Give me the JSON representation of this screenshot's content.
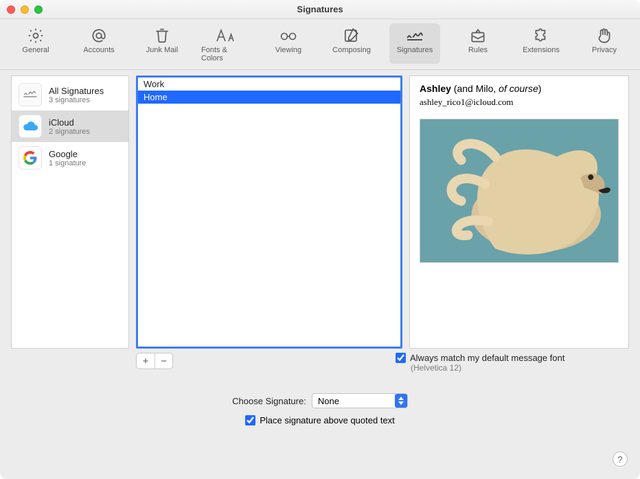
{
  "window": {
    "title": "Signatures"
  },
  "toolbar": {
    "items": [
      {
        "label": "General"
      },
      {
        "label": "Accounts"
      },
      {
        "label": "Junk Mail"
      },
      {
        "label": "Fonts & Colors"
      },
      {
        "label": "Viewing"
      },
      {
        "label": "Composing"
      },
      {
        "label": "Signatures"
      },
      {
        "label": "Rules"
      },
      {
        "label": "Extensions"
      },
      {
        "label": "Privacy"
      }
    ]
  },
  "accounts": [
    {
      "name": "All Signatures",
      "sub": "3 signatures",
      "icon": "all"
    },
    {
      "name": "iCloud",
      "sub": "2 signatures",
      "icon": "cloud"
    },
    {
      "name": "Google",
      "sub": "1 signature",
      "icon": "google"
    }
  ],
  "signatures": [
    {
      "label": "Work"
    },
    {
      "label": "Home"
    }
  ],
  "preview": {
    "name_bold": "Ashley",
    "name_paren_plain": " (and Milo, ",
    "name_italic": "of course",
    "name_paren_close": ")",
    "email": "ashley_rico1@icloud.com"
  },
  "buttons": {
    "add": "+",
    "remove": "−"
  },
  "checkboxes": {
    "match_font_label": "Always match my default message font",
    "match_font_sub": "(Helvetica 12)",
    "place_above_label": "Place signature above quoted text"
  },
  "choose": {
    "label": "Choose Signature:",
    "value": "None"
  },
  "help": {
    "glyph": "?"
  }
}
